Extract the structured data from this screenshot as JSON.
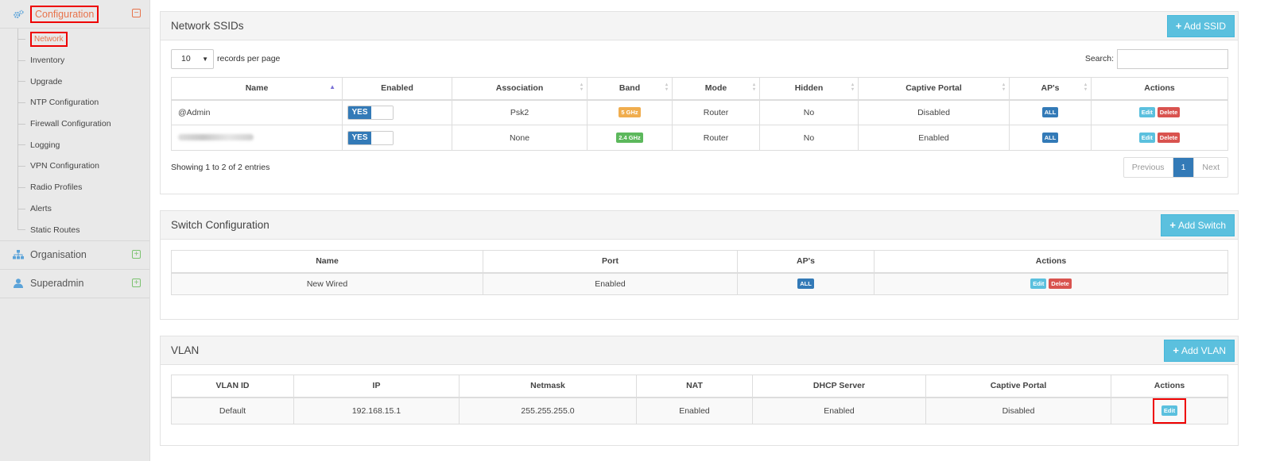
{
  "sidebar": {
    "config_label": "Configuration",
    "items": [
      "Network",
      "Inventory",
      "Upgrade",
      "NTP Configuration",
      "Firewall Configuration",
      "Logging",
      "VPN Configuration",
      "Radio Profiles",
      "Alerts",
      "Static Routes"
    ],
    "org_label": "Organisation",
    "superadmin_label": "Superadmin"
  },
  "ssid": {
    "title": "Network SSIDs",
    "add_label": "Add SSID",
    "page_size": "10",
    "records_label": "records per page",
    "search_label": "Search:",
    "columns": [
      "Name",
      "Enabled",
      "Association",
      "Band",
      "Mode",
      "Hidden",
      "Captive Portal",
      "AP's",
      "Actions"
    ],
    "rows": [
      {
        "name": "@Admin",
        "enabled": "YES",
        "association": "Psk2",
        "band": "5 GHz",
        "mode": "Router",
        "hidden": "No",
        "captive": "Disabled",
        "aps": "ALL",
        "edit": "Edit",
        "delete": "Delete"
      },
      {
        "name": "",
        "enabled": "YES",
        "association": "None",
        "band": "2.4 GHz",
        "mode": "Router",
        "hidden": "No",
        "captive": "Enabled",
        "aps": "ALL",
        "edit": "Edit",
        "delete": "Delete"
      }
    ],
    "showing": "Showing 1 to 2 of 2 entries",
    "prev": "Previous",
    "page": "1",
    "next": "Next"
  },
  "switch": {
    "title": "Switch Configuration",
    "add_label": "Add Switch",
    "columns": [
      "Name",
      "Port",
      "AP's",
      "Actions"
    ],
    "row": {
      "name": "New Wired",
      "port": "Enabled",
      "aps": "ALL",
      "edit": "Edit",
      "delete": "Delete"
    }
  },
  "vlan": {
    "title": "VLAN",
    "add_label": "Add VLAN",
    "columns": [
      "VLAN ID",
      "IP",
      "Netmask",
      "NAT",
      "DHCP Server",
      "Captive Portal",
      "Actions"
    ],
    "row": {
      "id": "Default",
      "ip": "192.168.15.1",
      "netmask": "255.255.255.0",
      "nat": "Enabled",
      "dhcp": "Enabled",
      "captive": "Disabled",
      "edit": "Edit"
    }
  },
  "colors": {
    "accent": "#5bc0de",
    "primary": "#337ab7",
    "danger": "#d9534f",
    "highlight": "#ff0000"
  }
}
